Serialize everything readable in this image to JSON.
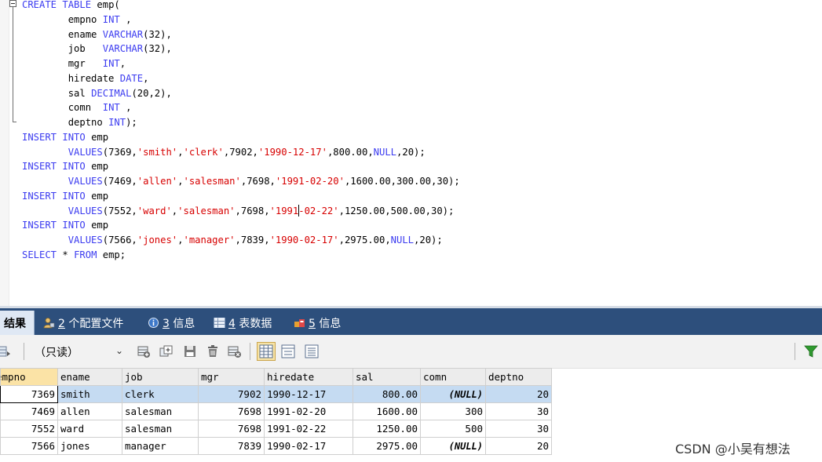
{
  "editor": {
    "lines": [
      [
        {
          "t": "CREATE TABLE ",
          "c": "kw"
        },
        {
          "t": "emp(",
          "c": "pl"
        }
      ],
      [
        {
          "t": "        empno ",
          "c": "pl"
        },
        {
          "t": "INT",
          "c": "kw"
        },
        {
          "t": " ,",
          "c": "pl"
        }
      ],
      [
        {
          "t": "        ename ",
          "c": "pl"
        },
        {
          "t": "VARCHAR",
          "c": "kw"
        },
        {
          "t": "(32),",
          "c": "pl"
        }
      ],
      [
        {
          "t": "        job   ",
          "c": "pl"
        },
        {
          "t": "VARCHAR",
          "c": "kw"
        },
        {
          "t": "(32),",
          "c": "pl"
        }
      ],
      [
        {
          "t": "        mgr   ",
          "c": "pl"
        },
        {
          "t": "INT",
          "c": "kw"
        },
        {
          "t": ",",
          "c": "pl"
        }
      ],
      [
        {
          "t": "        hiredate ",
          "c": "pl"
        },
        {
          "t": "DATE",
          "c": "kw"
        },
        {
          "t": ",",
          "c": "pl"
        }
      ],
      [
        {
          "t": "        sal ",
          "c": "pl"
        },
        {
          "t": "DECIMAL",
          "c": "kw"
        },
        {
          "t": "(20,2),",
          "c": "pl"
        }
      ],
      [
        {
          "t": "        comn  ",
          "c": "pl"
        },
        {
          "t": "INT",
          "c": "kw"
        },
        {
          "t": " ,",
          "c": "pl"
        }
      ],
      [
        {
          "t": "        deptno ",
          "c": "pl"
        },
        {
          "t": "INT",
          "c": "kw"
        },
        {
          "t": ");",
          "c": "pl"
        }
      ],
      [
        {
          "t": "INSERT INTO ",
          "c": "kw"
        },
        {
          "t": "emp",
          "c": "pl"
        }
      ],
      [
        {
          "t": "        VALUES",
          "c": "kw"
        },
        {
          "t": "(7369,",
          "c": "pl"
        },
        {
          "t": "'smith'",
          "c": "str"
        },
        {
          "t": ",",
          "c": "pl"
        },
        {
          "t": "'clerk'",
          "c": "str"
        },
        {
          "t": ",7902,",
          "c": "pl"
        },
        {
          "t": "'1990-12-17'",
          "c": "str"
        },
        {
          "t": ",800.00,",
          "c": "pl"
        },
        {
          "t": "NULL",
          "c": "kw"
        },
        {
          "t": ",20);",
          "c": "pl"
        }
      ],
      [
        {
          "t": "INSERT INTO ",
          "c": "kw"
        },
        {
          "t": "emp",
          "c": "pl"
        }
      ],
      [
        {
          "t": "        VALUES",
          "c": "kw"
        },
        {
          "t": "(7469,",
          "c": "pl"
        },
        {
          "t": "'allen'",
          "c": "str"
        },
        {
          "t": ",",
          "c": "pl"
        },
        {
          "t": "'salesman'",
          "c": "str"
        },
        {
          "t": ",7698,",
          "c": "pl"
        },
        {
          "t": "'1991-02-20'",
          "c": "str"
        },
        {
          "t": ",1600.00,300.00,30);",
          "c": "pl"
        }
      ],
      [
        {
          "t": "INSERT INTO ",
          "c": "kw"
        },
        {
          "t": "emp",
          "c": "pl"
        }
      ],
      [
        {
          "t": "        VALUES",
          "c": "kw"
        },
        {
          "t": "(7552,",
          "c": "pl"
        },
        {
          "t": "'ward'",
          "c": "str"
        },
        {
          "t": ",",
          "c": "pl"
        },
        {
          "t": "'salesman'",
          "c": "str"
        },
        {
          "t": ",7698,",
          "c": "pl"
        },
        {
          "t": "'1991",
          "c": "str"
        },
        {
          "t": "",
          "c": "caret"
        },
        {
          "t": "-02-22'",
          "c": "str"
        },
        {
          "t": ",1250.00,500.00,30);",
          "c": "pl"
        }
      ],
      [
        {
          "t": "INSERT INTO ",
          "c": "kw"
        },
        {
          "t": "emp",
          "c": "pl"
        }
      ],
      [
        {
          "t": "        VALUES",
          "c": "kw"
        },
        {
          "t": "(7566,",
          "c": "pl"
        },
        {
          "t": "'jones'",
          "c": "str"
        },
        {
          "t": ",",
          "c": "pl"
        },
        {
          "t": "'manager'",
          "c": "str"
        },
        {
          "t": ",7839,",
          "c": "pl"
        },
        {
          "t": "'1990-02-17'",
          "c": "str"
        },
        {
          "t": ",2975.00,",
          "c": "pl"
        },
        {
          "t": "NULL",
          "c": "kw"
        },
        {
          "t": ",20);",
          "c": "pl"
        }
      ],
      [
        {
          "t": "SELECT ",
          "c": "kw"
        },
        {
          "t": "* ",
          "c": "pl"
        },
        {
          "t": "FROM ",
          "c": "kw"
        },
        {
          "t": "emp;",
          "c": "pl"
        }
      ]
    ]
  },
  "tabs": [
    {
      "num": "",
      "label": "结果",
      "icon": ""
    },
    {
      "num": "2",
      "label": "个配置文件",
      "icon": "profile-icon"
    },
    {
      "num": "3",
      "label": "信息",
      "icon": "info-icon"
    },
    {
      "num": "4",
      "label": "表数据",
      "icon": "table-data-icon"
    },
    {
      "num": "5",
      "label": "信息",
      "icon": "info-alt-icon"
    }
  ],
  "toolbar": {
    "mode_label": "（只读）",
    "icons": [
      "export-icon",
      "add-row-icon",
      "duplicate-row-icon",
      "save-icon",
      "delete-icon",
      "discard-icon",
      "grid-view-icon",
      "form-view-icon",
      "text-view-icon",
      "filter-icon"
    ]
  },
  "grid": {
    "columns": [
      "empno",
      "ename",
      "job",
      "mgr",
      "hiredate",
      "sal",
      "comn",
      "deptno"
    ],
    "rows": [
      [
        "7369",
        "smith",
        "clerk",
        "7902",
        "1990-12-17",
        "800.00",
        "(NULL)",
        "20"
      ],
      [
        "7469",
        "allen",
        "salesman",
        "7698",
        "1991-02-20",
        "1600.00",
        "300",
        "30"
      ],
      [
        "7552",
        "ward",
        "salesman",
        "7698",
        "1991-02-22",
        "1250.00",
        "500",
        "30"
      ],
      [
        "7566",
        "jones",
        "manager",
        "7839",
        "1990-02-17",
        "2975.00",
        "(NULL)",
        "20"
      ]
    ]
  },
  "watermark": "CSDN @小吴有想法",
  "colors": {
    "keyword": "#3c3cf0",
    "string": "#d70000",
    "tabbar": "#2d4f7c",
    "selected_row": "#c5dbf2",
    "header_highlight": "#fbe3a6"
  }
}
